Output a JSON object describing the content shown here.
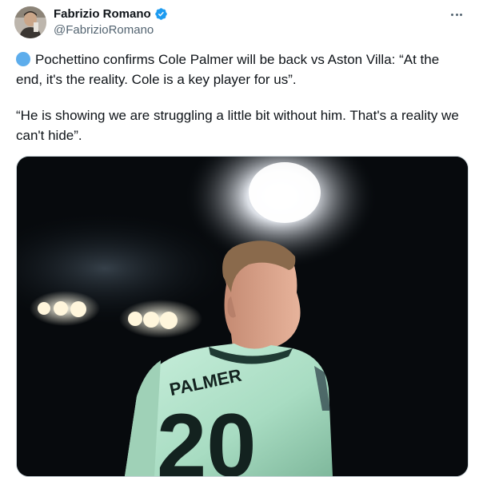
{
  "author": {
    "display_name": "Fabrizio Romano",
    "handle": "@FabrizioRomano"
  },
  "tweet": {
    "paragraph1": "Pochettino confirms Cole Palmer will be back vs Aston Villa: “At the end, it's the reality. Cole is a key player for us”.",
    "paragraph2": "“He is showing we are struggling a little bit without him. That's a reality we can't hide”."
  },
  "media": {
    "shirt_name": "PALMER",
    "shirt_number": "20"
  },
  "colors": {
    "verified_blue": "#1d9bf0",
    "blue_circle": "#5dadec",
    "jersey_mint": "#b8e6cf"
  },
  "icons": {
    "more": "more-horizontal-icon",
    "verified": "verified-badge-icon",
    "blue_circle": "blue-circle-emoji"
  }
}
